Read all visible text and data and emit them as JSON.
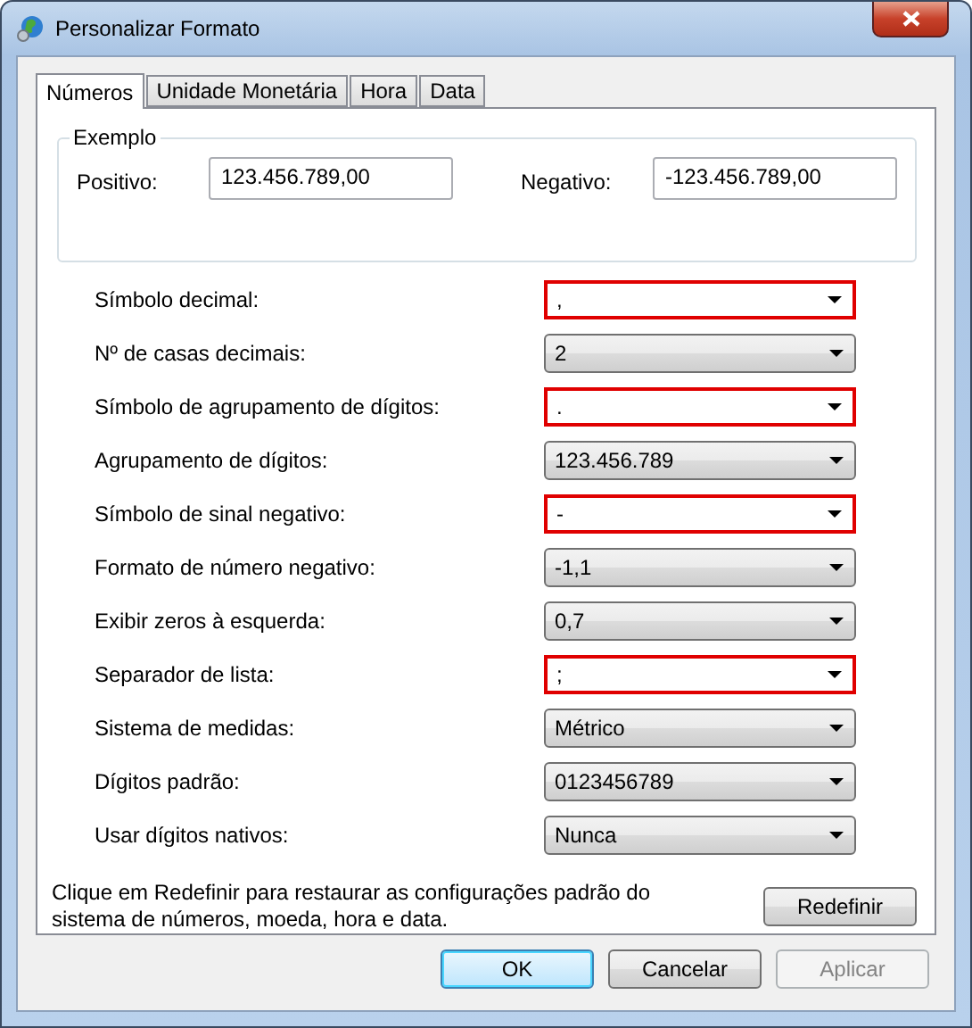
{
  "window": {
    "title": "Personalizar Formato"
  },
  "tabs": [
    {
      "label": "Números",
      "selected": true
    },
    {
      "label": "Unidade Monetária",
      "selected": false
    },
    {
      "label": "Hora",
      "selected": false
    },
    {
      "label": "Data",
      "selected": false
    }
  ],
  "example": {
    "title": "Exemplo",
    "positive_label": "Positivo:",
    "positive_value": "123.456.789,00",
    "negative_label": "Negativo:",
    "negative_value": "-123.456.789,00"
  },
  "settings": [
    {
      "label": "Símbolo decimal:",
      "value": ",",
      "kind": "editable",
      "highlighted": true
    },
    {
      "label": "Nº de casas decimais:",
      "value": "2",
      "kind": "dropdown",
      "highlighted": false
    },
    {
      "label": "Símbolo de agrupamento de dígitos:",
      "value": ".",
      "kind": "editable",
      "highlighted": true
    },
    {
      "label": "Agrupamento de dígitos:",
      "value": "123.456.789",
      "kind": "dropdown",
      "highlighted": false
    },
    {
      "label": "Símbolo de sinal negativo:",
      "value": "-",
      "kind": "editable",
      "highlighted": true
    },
    {
      "label": "Formato de número negativo:",
      "value": "-1,1",
      "kind": "dropdown",
      "highlighted": false
    },
    {
      "label": "Exibir zeros à esquerda:",
      "value": "0,7",
      "kind": "dropdown",
      "highlighted": false
    },
    {
      "label": "Separador de lista:",
      "value": ";",
      "kind": "editable",
      "highlighted": true
    },
    {
      "label": "Sistema de medidas:",
      "value": "Métrico",
      "kind": "dropdown",
      "highlighted": false
    },
    {
      "label": "Dígitos padrão:",
      "value": "0123456789",
      "kind": "dropdown",
      "highlighted": false
    },
    {
      "label": "Usar dígitos nativos:",
      "value": "Nunca",
      "kind": "dropdown",
      "highlighted": false
    }
  ],
  "reset": {
    "note": "Clique em Redefinir para restaurar as configurações padrão do sistema de números, moeda, hora e data.",
    "button": "Redefinir"
  },
  "buttons": [
    {
      "label": "OK",
      "default": true,
      "disabled": false
    },
    {
      "label": "Cancelar",
      "default": false,
      "disabled": false
    },
    {
      "label": "Aplicar",
      "default": false,
      "disabled": true
    }
  ]
}
